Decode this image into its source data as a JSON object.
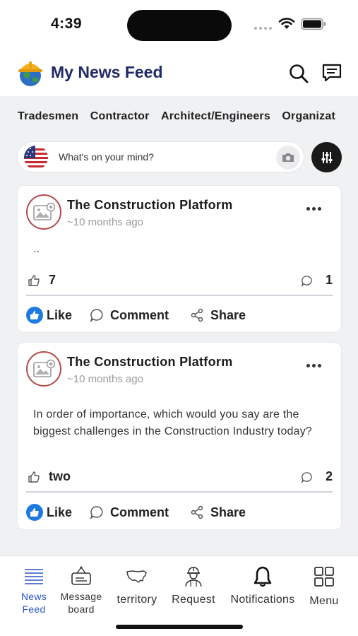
{
  "status_bar": {
    "time": "4:39"
  },
  "header": {
    "title": "My News Feed",
    "logo_icon": "hardhat-globe-icon"
  },
  "categories": [
    "Tradesmen",
    "Contractor",
    "Architect/Engineers",
    "Organizat"
  ],
  "composer": {
    "placeholder": "What's on your mind?"
  },
  "posts": [
    {
      "author": "The Construction Platform",
      "time": "~10 months ago",
      "body": "..",
      "likes": "7",
      "comments": "1",
      "actions": {
        "like": "Like",
        "comment": "Comment",
        "share": "Share"
      }
    },
    {
      "author": "The Construction Platform",
      "time": "~10 months ago",
      "body": "In order of importance, which would you say are the biggest challenges in the Construction Industry today?",
      "likes": "two",
      "comments": "2",
      "actions": {
        "like": "Like",
        "comment": "Comment",
        "share": "Share"
      }
    }
  ],
  "bottom_nav": [
    {
      "label_line1": "News",
      "label_line2": "Feed",
      "icon": "list-icon",
      "active": true
    },
    {
      "label_line1": "Message",
      "label_line2": "board",
      "icon": "message-board-icon",
      "active": false
    },
    {
      "label_line1": "territory",
      "icon": "usa-map-icon",
      "active": false
    },
    {
      "label_line1": "Request",
      "icon": "worker-icon",
      "active": false
    },
    {
      "label_line1": "Notifications",
      "icon": "bell-icon",
      "active": false
    },
    {
      "label_line1": "Menu",
      "icon": "grid-icon",
      "active": false
    }
  ],
  "colors": {
    "brand": "#1f2a68",
    "accent": "#2c57c7",
    "like_blue": "#1d7be0"
  }
}
